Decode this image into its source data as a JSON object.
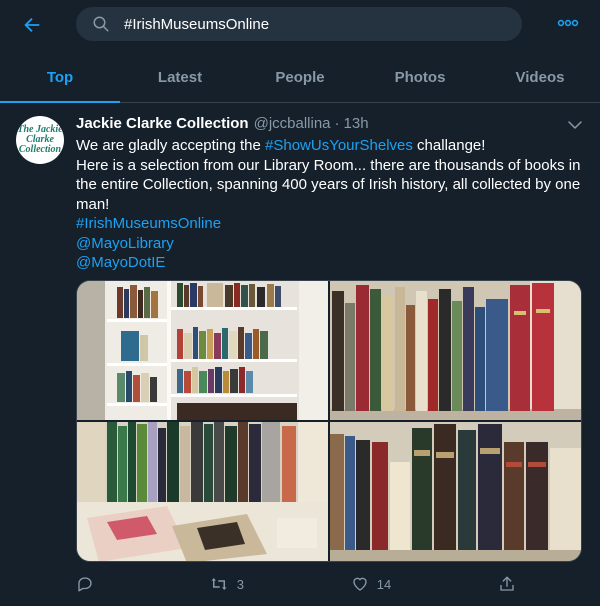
{
  "search": {
    "query": "#IrishMuseumsOnline"
  },
  "tabs": [
    {
      "label": "Top",
      "active": true
    },
    {
      "label": "Latest",
      "active": false
    },
    {
      "label": "People",
      "active": false
    },
    {
      "label": "Photos",
      "active": false
    },
    {
      "label": "Videos",
      "active": false
    }
  ],
  "tweet": {
    "avatar_text": [
      "The Jackie",
      "Clarke",
      "Collection"
    ],
    "name": "Jackie Clarke Collection",
    "handle": "@jccballina",
    "dot": "·",
    "time": "13h",
    "text_line1_prefix": "We are gladly accepting the ",
    "text_line1_hashtag": "#ShowUsYourShelves",
    "text_line1_suffix": " challange!",
    "text_line2": "Here is a selection  from our Library Room... there are thousands of books in the entire Collection, spanning 400 years of Irish history, all collected by one man!",
    "hashtag": "#IrishMuseumsOnline",
    "mention1": "@MayoLibrary",
    "mention2": "@MayoDotIE",
    "reply_count": "",
    "retweet_count": "3",
    "like_count": "14"
  },
  "colors": {
    "background": "#15202b",
    "accent": "#1da1f2",
    "secondary_text": "#8899a6",
    "divider": "#38444d"
  },
  "icons": {
    "back": "arrow-left-icon",
    "search": "search-icon",
    "more": "more-horizontal-icon",
    "caret": "chevron-down-icon",
    "reply": "reply-icon",
    "retweet": "retweet-icon",
    "like": "heart-icon",
    "share": "share-icon"
  }
}
